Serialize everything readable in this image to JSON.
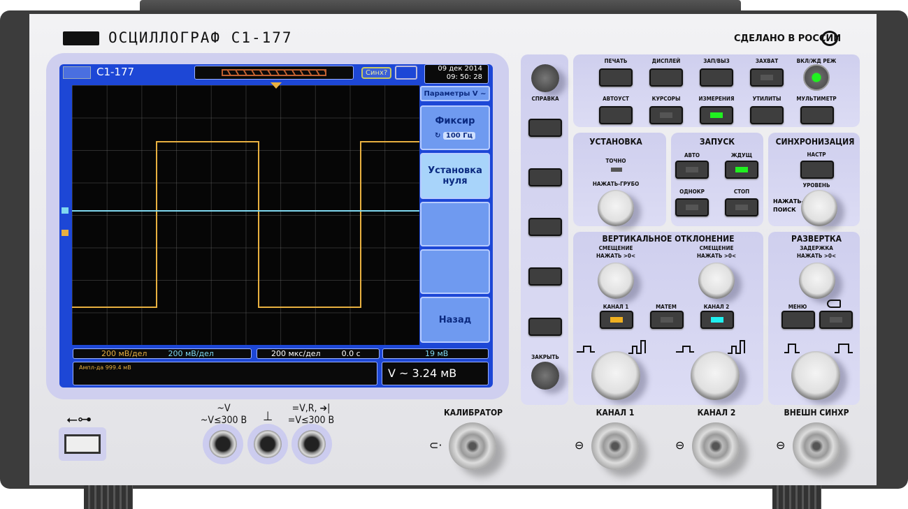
{
  "header": {
    "title": "ОСЦИЛЛОГРАФ С1-177",
    "made_in": "СДЕЛАНО В РОССИИ"
  },
  "screen": {
    "model": "С1-177",
    "sync_status": "Синх?",
    "date": "09 дек 2014",
    "time": "09: 50: 28",
    "menu": {
      "title": "Параметры V ~",
      "items": [
        {
          "label": "Фиксир",
          "value": "100 Гц"
        },
        {
          "label": "Установка нуля"
        },
        {
          "label": ""
        },
        {
          "label": ""
        },
        {
          "label": "Назад"
        }
      ]
    },
    "status": {
      "ch1_scale": "200 мВ/дел",
      "ch2_scale": "200 мВ/дел",
      "timebase": "200 мкс/дел",
      "h_pos": "0.0 с",
      "trig_level": "19 мВ",
      "measurement": "Ампл-да 999.4 мВ",
      "readout": "V ~ 3.24 мВ"
    },
    "colors": {
      "ch1": "#e8b040",
      "ch2": "#7fd8f0",
      "screen": "#1d47d6"
    }
  },
  "side": {
    "help": "СПРАВКА",
    "close": "ЗАКРЫТЬ"
  },
  "top_buttons": [
    {
      "label": "ПЕЧАТЬ"
    },
    {
      "label": "ДИСПЛЕЙ"
    },
    {
      "label": "ЗАП/ВЫЗ"
    },
    {
      "label": "ЗАХВАТ"
    },
    {
      "label": "ВКЛ/ЖД РЕЖ"
    },
    {
      "label": "АВТОУСТ"
    },
    {
      "label": "КУРСОРЫ"
    },
    {
      "label": "ИЗМЕРЕНИЯ"
    },
    {
      "label": "УТИЛИТЫ"
    },
    {
      "label": "МУЛЬТИМЕТР"
    }
  ],
  "setup": {
    "title": "УСТАНОВКА",
    "fine": "ТОЧНО",
    "knob": "НАЖАТЬ-ГРУБО"
  },
  "trigger": {
    "title": "ЗАПУСК",
    "auto": "АВТО",
    "normal": "ЖДУЩ",
    "single": "ОДНОКР",
    "stop": "СТОП"
  },
  "sync": {
    "title": "СИНХРОНИЗАЦИЯ",
    "setup": "НАСТР",
    "level": "УРОВЕНЬ",
    "push": "НАЖАТЬ-\nПОИСК"
  },
  "vertical": {
    "title": "ВЕРТИКАЛЬНОЕ ОТКЛОНЕНИЕ",
    "offset1": "СМЕЩЕНИЕ",
    "push1": "НАЖАТЬ >0<",
    "offset2": "СМЕЩЕНИЕ",
    "push2": "НАЖАТЬ >0<",
    "ch1": "КАНАЛ 1",
    "math": "МАТЕМ",
    "ch2": "КАНАЛ 2"
  },
  "horizontal": {
    "title": "РАЗВЕРТКА",
    "delay": "ЗАДЕРЖКА",
    "push": "НАЖАТЬ >0<",
    "menu": "МЕНЮ"
  },
  "inputs": {
    "meter_ac": "~V",
    "meter_ac_limit": "~V≤300 В",
    "ground": "⊥",
    "meter_dc": "=V,R, ➔|",
    "meter_dc_limit": "=V≤300 В",
    "calibrator": "КАЛИБРАТОР",
    "ch1": "КАНАЛ 1",
    "ch2": "КАНАЛ 2",
    "ext": "ВНЕШН СИНХР"
  }
}
